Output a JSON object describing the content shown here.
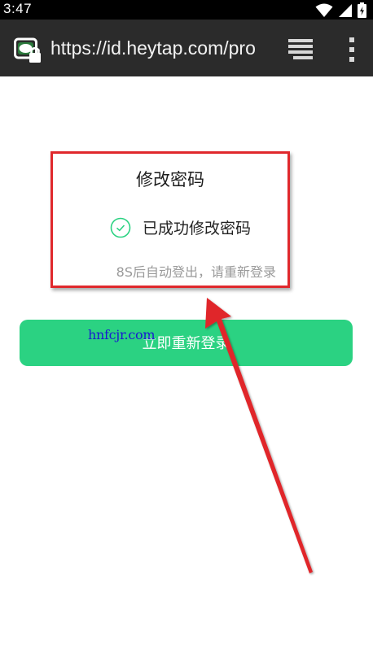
{
  "status_bar": {
    "time": "3:47"
  },
  "browser": {
    "url": "https://id.heytap.com/pro"
  },
  "dialog": {
    "title": "修改密码",
    "success_message": "已成功修改密码",
    "logout_hint": "8S后自动登出，请重新登录"
  },
  "actions": {
    "relogin_label": "立即重新登录"
  },
  "watermark": {
    "text": "hnfcjr.com"
  },
  "colors": {
    "accent_green": "#2bd282",
    "highlight_red": "#e0282c",
    "url_bar_bg": "#2b2b2b"
  }
}
